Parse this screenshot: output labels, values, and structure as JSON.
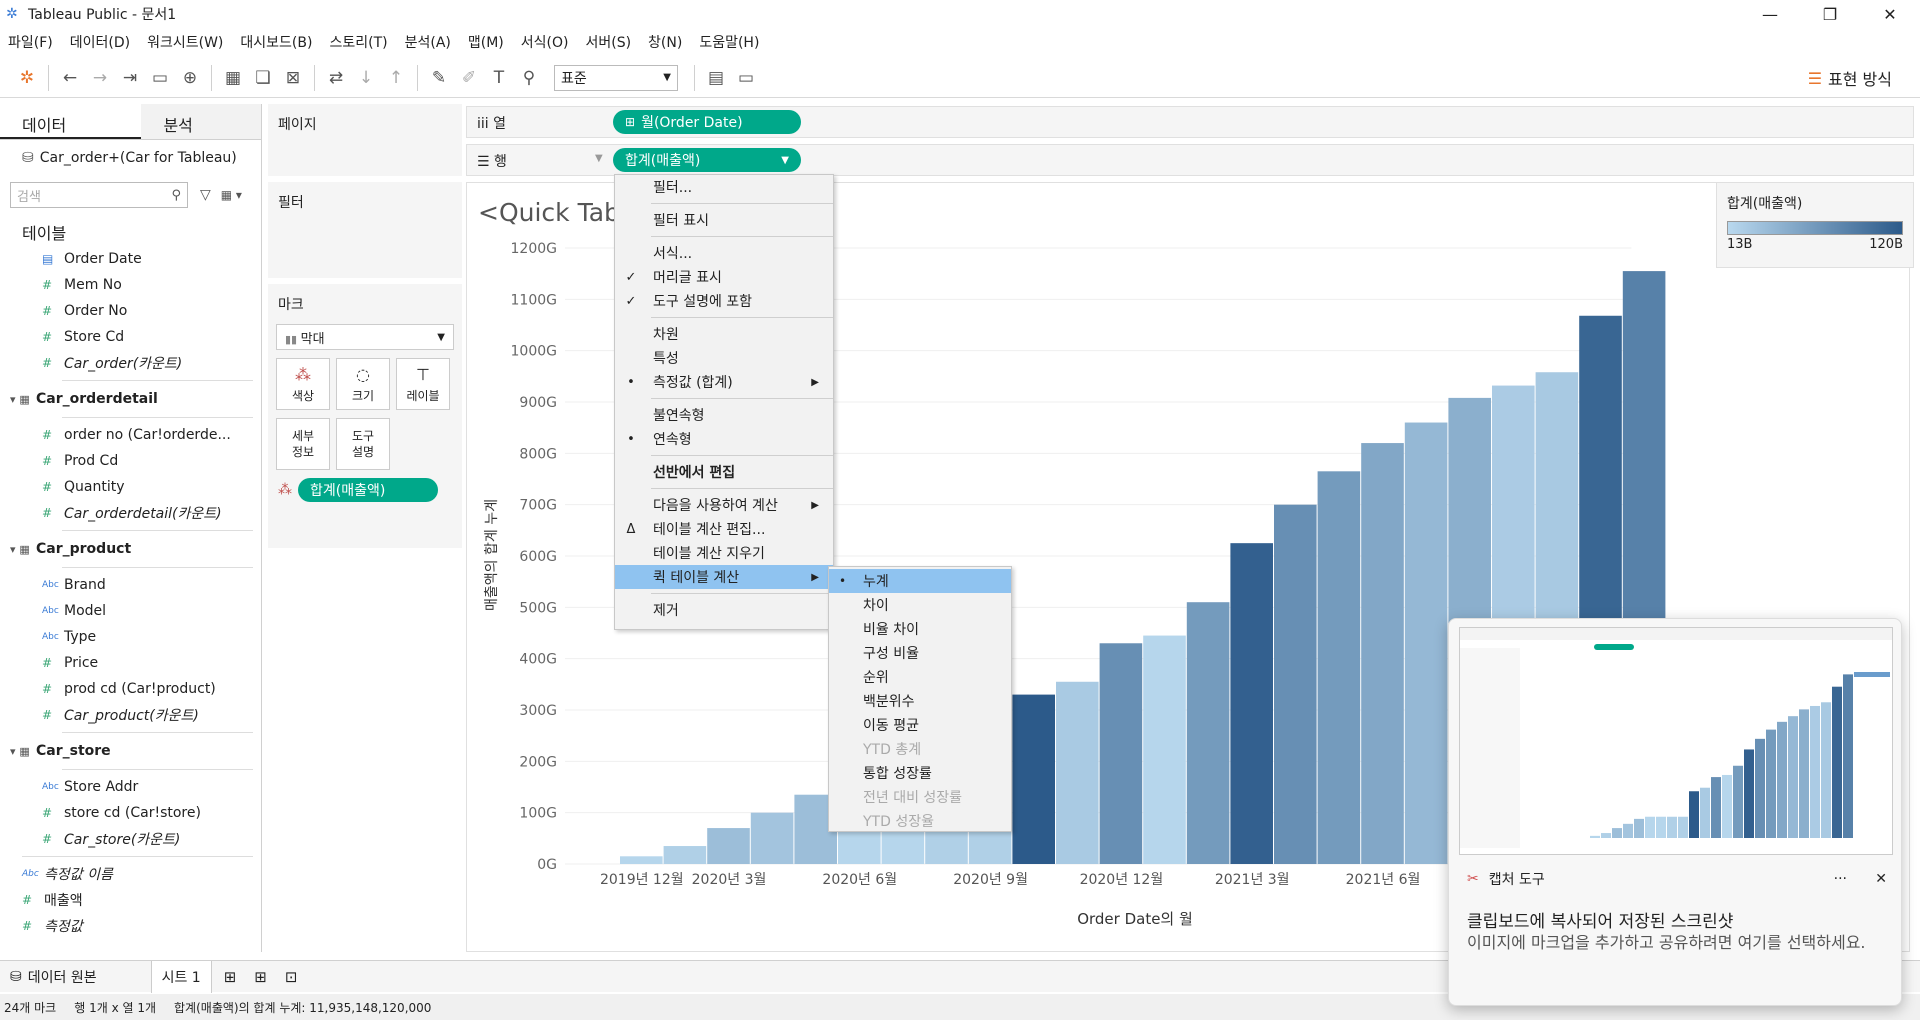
{
  "window": {
    "title": "Tableau Public - 문서1",
    "min": "—",
    "max": "❐",
    "close": "✕"
  },
  "menu": [
    "파일(F)",
    "데이터(D)",
    "워크시트(W)",
    "대시보드(B)",
    "스토리(T)",
    "분석(A)",
    "맵(M)",
    "서식(O)",
    "서버(S)",
    "창(N)",
    "도움말(H)"
  ],
  "toolbar": {
    "fit_select": "표준",
    "show_me": "표현 방식"
  },
  "data_pane": {
    "tab_data": "데이터",
    "tab_analytics": "분석",
    "datasource": "Car_order+(Car for Tableau)",
    "search_placeholder": "검색",
    "tables_header": "테이블",
    "table_items": [
      {
        "icon": "date",
        "name": "Order Date",
        "italic": false
      },
      {
        "icon": "num",
        "name": "Mem No",
        "italic": false
      },
      {
        "icon": "num",
        "name": "Order No",
        "italic": false
      },
      {
        "icon": "num",
        "name": "Store Cd",
        "italic": false
      },
      {
        "icon": "num",
        "name": "Car_order(카운트)",
        "italic": true
      }
    ],
    "groups": [
      {
        "name": "Car_orderdetail",
        "items": [
          {
            "icon": "num",
            "name": "order no (Car!orderde...",
            "italic": false
          },
          {
            "icon": "num",
            "name": "Prod Cd",
            "italic": false
          },
          {
            "icon": "num",
            "name": "Quantity",
            "italic": false
          },
          {
            "icon": "num",
            "name": "Car_orderdetail(카운트)",
            "italic": true
          }
        ]
      },
      {
        "name": "Car_product",
        "items": [
          {
            "icon": "abc",
            "name": "Brand",
            "italic": false
          },
          {
            "icon": "abc",
            "name": "Model",
            "italic": false
          },
          {
            "icon": "abc",
            "name": "Type",
            "italic": false
          },
          {
            "icon": "num",
            "name": "Price",
            "italic": false
          },
          {
            "icon": "num",
            "name": "prod cd (Car!product)",
            "italic": false
          },
          {
            "icon": "num",
            "name": "Car_product(카운트)",
            "italic": true
          }
        ]
      },
      {
        "name": "Car_store",
        "items": [
          {
            "icon": "abc",
            "name": "Store Addr",
            "italic": false
          },
          {
            "icon": "num",
            "name": "store cd (Car!store)",
            "italic": false
          },
          {
            "icon": "num",
            "name": "Car_store(카운트)",
            "italic": true
          }
        ]
      }
    ],
    "bottom_items": [
      {
        "icon": "abc",
        "name": "측정값 이름",
        "italic": true
      },
      {
        "icon": "num",
        "name": "매출액",
        "italic": false
      },
      {
        "icon": "num",
        "name": "측정값",
        "italic": true
      }
    ]
  },
  "cards": {
    "pages": "페이지",
    "filters": "필터",
    "marks": "마크",
    "mark_type": "막대",
    "mark_buttons": [
      {
        "icon": "color-icon",
        "label": "색상"
      },
      {
        "icon": "size-icon",
        "label": "크기"
      },
      {
        "icon": "label-icon",
        "label": "레이블"
      },
      {
        "icon": "detail-icon",
        "label": "세부\n정보"
      },
      {
        "icon": "tooltip-icon",
        "label": "도구\n설명"
      }
    ],
    "marks_pill": "합계(매출액)"
  },
  "shelves": {
    "columns_label": "열",
    "rows_label": "행",
    "columns_pill": "월(Order Date)",
    "rows_pill": "합계(매출액)"
  },
  "view": {
    "title": "<Quick Tabl",
    "xlabel": "Order Date의 월",
    "ylabel": "매출액의 합계 누계"
  },
  "legend": {
    "title": "합계(매출액)",
    "min": "13B",
    "max": "120B",
    "color_low": "#b9d8ee",
    "color_high": "#2c5a8a"
  },
  "context_menu": [
    {
      "label": "필터...",
      "mark": "",
      "arrow": false,
      "bold": false,
      "hl": false
    },
    {
      "sep": true
    },
    {
      "label": "필터 표시",
      "mark": "",
      "arrow": false,
      "bold": false,
      "hl": false
    },
    {
      "sep": true
    },
    {
      "label": "서식...",
      "mark": "",
      "arrow": false,
      "bold": false,
      "hl": false
    },
    {
      "label": "머리글 표시",
      "mark": "check",
      "arrow": false,
      "bold": false,
      "hl": false
    },
    {
      "label": "도구 설명에 포함",
      "mark": "check",
      "arrow": false,
      "bold": false,
      "hl": false
    },
    {
      "sep": true
    },
    {
      "label": "차원",
      "mark": "",
      "arrow": false,
      "bold": false,
      "hl": false
    },
    {
      "label": "특성",
      "mark": "",
      "arrow": false,
      "bold": false,
      "hl": false
    },
    {
      "label": "측정값 (합계)",
      "mark": "dot",
      "arrow": true,
      "bold": false,
      "hl": false
    },
    {
      "sep": true
    },
    {
      "label": "불연속형",
      "mark": "",
      "arrow": false,
      "bold": false,
      "hl": false
    },
    {
      "label": "연속형",
      "mark": "dot",
      "arrow": false,
      "bold": false,
      "hl": false
    },
    {
      "sep": true
    },
    {
      "label": "선반에서 편집",
      "mark": "",
      "arrow": false,
      "bold": true,
      "hl": false
    },
    {
      "sep": true
    },
    {
      "label": "다음을 사용하여 계산",
      "mark": "",
      "arrow": true,
      "bold": false,
      "hl": false
    },
    {
      "label": "테이블 계산 편집...",
      "mark": "delta",
      "arrow": false,
      "bold": false,
      "hl": false
    },
    {
      "label": "테이블 계산 지우기",
      "mark": "",
      "arrow": false,
      "bold": false,
      "hl": false
    },
    {
      "label": "퀵 테이블 계산",
      "mark": "",
      "arrow": true,
      "bold": false,
      "hl": true
    },
    {
      "sep": true
    },
    {
      "label": "제거",
      "mark": "",
      "arrow": false,
      "bold": false,
      "hl": false
    }
  ],
  "submenu": [
    {
      "label": "누계",
      "checked": true,
      "disabled": false
    },
    {
      "label": "차이",
      "checked": false,
      "disabled": false
    },
    {
      "label": "비율 차이",
      "checked": false,
      "disabled": false
    },
    {
      "label": "구성 비율",
      "checked": false,
      "disabled": false
    },
    {
      "label": "순위",
      "checked": false,
      "disabled": false
    },
    {
      "label": "백분위수",
      "checked": false,
      "disabled": false
    },
    {
      "label": "이동 평균",
      "checked": false,
      "disabled": false
    },
    {
      "label": "YTD 총계",
      "checked": false,
      "disabled": true
    },
    {
      "label": "통합 성장률",
      "checked": false,
      "disabled": false
    },
    {
      "label": "전년 대비 성장률",
      "checked": false,
      "disabled": true
    },
    {
      "label": "YTD 성장율",
      "checked": false,
      "disabled": true
    }
  ],
  "sheet_tabs": {
    "datasource": "데이터 원본",
    "sheet1": "시트 1"
  },
  "status": {
    "marks": "24개 마크",
    "rows_cols": "행 1개 x 열 1개",
    "sum": "합계(매출액)의 합계 누계: 11,935,148,120,000"
  },
  "toast": {
    "app": "캡처 도구",
    "more": "···",
    "close": "✕",
    "heading": "클립보드에 복사되어 저장된 스크린샷",
    "body": "이미지에 마크업을 추가하고 공유하려면 여기를 선택하세요."
  },
  "chart_data": {
    "type": "bar",
    "xlabel": "Order Date의 월",
    "ylabel": "매출액의 합계 누계",
    "ylim": [
      0,
      1250
    ],
    "yticks": [
      "0G",
      "100G",
      "200G",
      "300G",
      "400G",
      "500G",
      "600G",
      "700G",
      "800G",
      "900G",
      "1000G",
      "1100G",
      "1200G"
    ],
    "xtick_labels": [
      {
        "index": 0,
        "label": "2019년 12월"
      },
      {
        "index": 2,
        "label": "2020년 3월"
      },
      {
        "index": 5,
        "label": "2020년 6월"
      },
      {
        "index": 8,
        "label": "2020년 9월"
      },
      {
        "index": 11,
        "label": "2020년 12월"
      },
      {
        "index": 14,
        "label": "2021년 3월"
      },
      {
        "index": 17,
        "label": "2021년 6월"
      }
    ],
    "values": [
      15,
      35,
      70,
      100,
      135,
      150,
      150,
      150,
      150,
      330,
      355,
      430,
      445,
      510,
      625,
      700,
      765,
      820,
      860,
      908,
      932,
      958,
      1068,
      1155
    ],
    "monthly": [
      15,
      20,
      35,
      30,
      35,
      15,
      15,
      20,
      20,
      120,
      25,
      75,
      15,
      65,
      115,
      75,
      65,
      55,
      40,
      48,
      24,
      26,
      110,
      87
    ]
  }
}
